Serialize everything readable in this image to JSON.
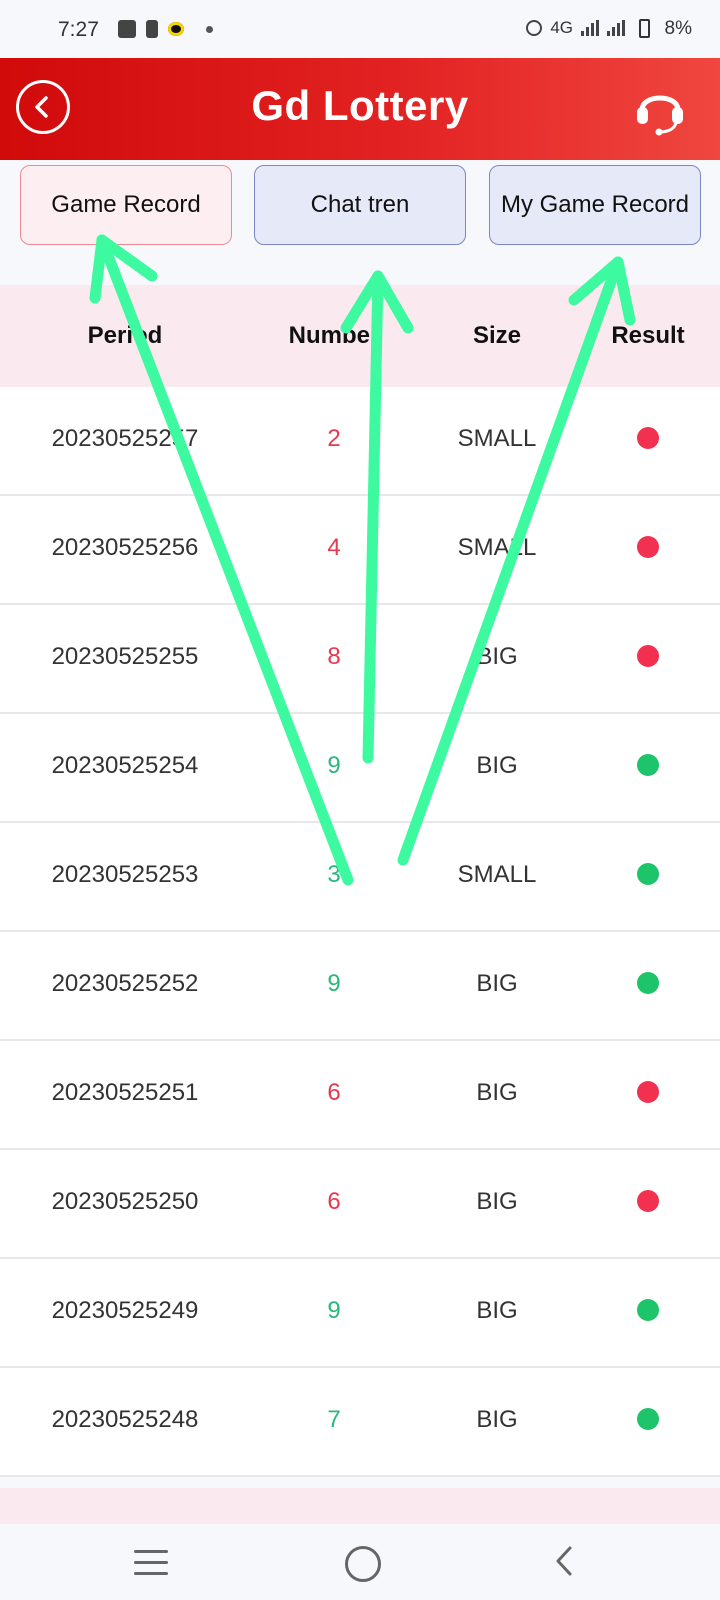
{
  "status_bar": {
    "time": "7:27",
    "network": "4G",
    "battery": "8%"
  },
  "header": {
    "title": "Gd Lottery",
    "back_icon": "back-circle-icon",
    "support_icon": "headset-icon"
  },
  "tabs": [
    {
      "label": "Game Record",
      "active": true
    },
    {
      "label": "Chat tren",
      "active": false
    },
    {
      "label": "My Game Record",
      "active": false
    }
  ],
  "table": {
    "headers": [
      "Period",
      "Number",
      "Size",
      "Result"
    ],
    "rows": [
      {
        "period": "20230525257",
        "number": "2",
        "size": "SMALL",
        "result": "red"
      },
      {
        "period": "20230525256",
        "number": "4",
        "size": "SMALL",
        "result": "red"
      },
      {
        "period": "20230525255",
        "number": "8",
        "size": "BIG",
        "result": "red"
      },
      {
        "period": "20230525254",
        "number": "9",
        "size": "BIG",
        "result": "green"
      },
      {
        "period": "20230525253",
        "number": "3",
        "size": "SMALL",
        "result": "green"
      },
      {
        "period": "20230525252",
        "number": "9",
        "size": "BIG",
        "result": "green"
      },
      {
        "period": "20230525251",
        "number": "6",
        "size": "BIG",
        "result": "red"
      },
      {
        "period": "20230525250",
        "number": "6",
        "size": "BIG",
        "result": "red"
      },
      {
        "period": "20230525249",
        "number": "9",
        "size": "BIG",
        "result": "green"
      },
      {
        "period": "20230525248",
        "number": "7",
        "size": "BIG",
        "result": "green"
      }
    ]
  },
  "colors": {
    "header_start": "#d10a0a",
    "header_end": "#f0463f",
    "red": "#f1314f",
    "green": "#1ec46a",
    "annotation": "#3dfaa0"
  },
  "navbar": {
    "icons": [
      "menu-icon",
      "home-circle-icon",
      "back-chevron-icon"
    ]
  }
}
